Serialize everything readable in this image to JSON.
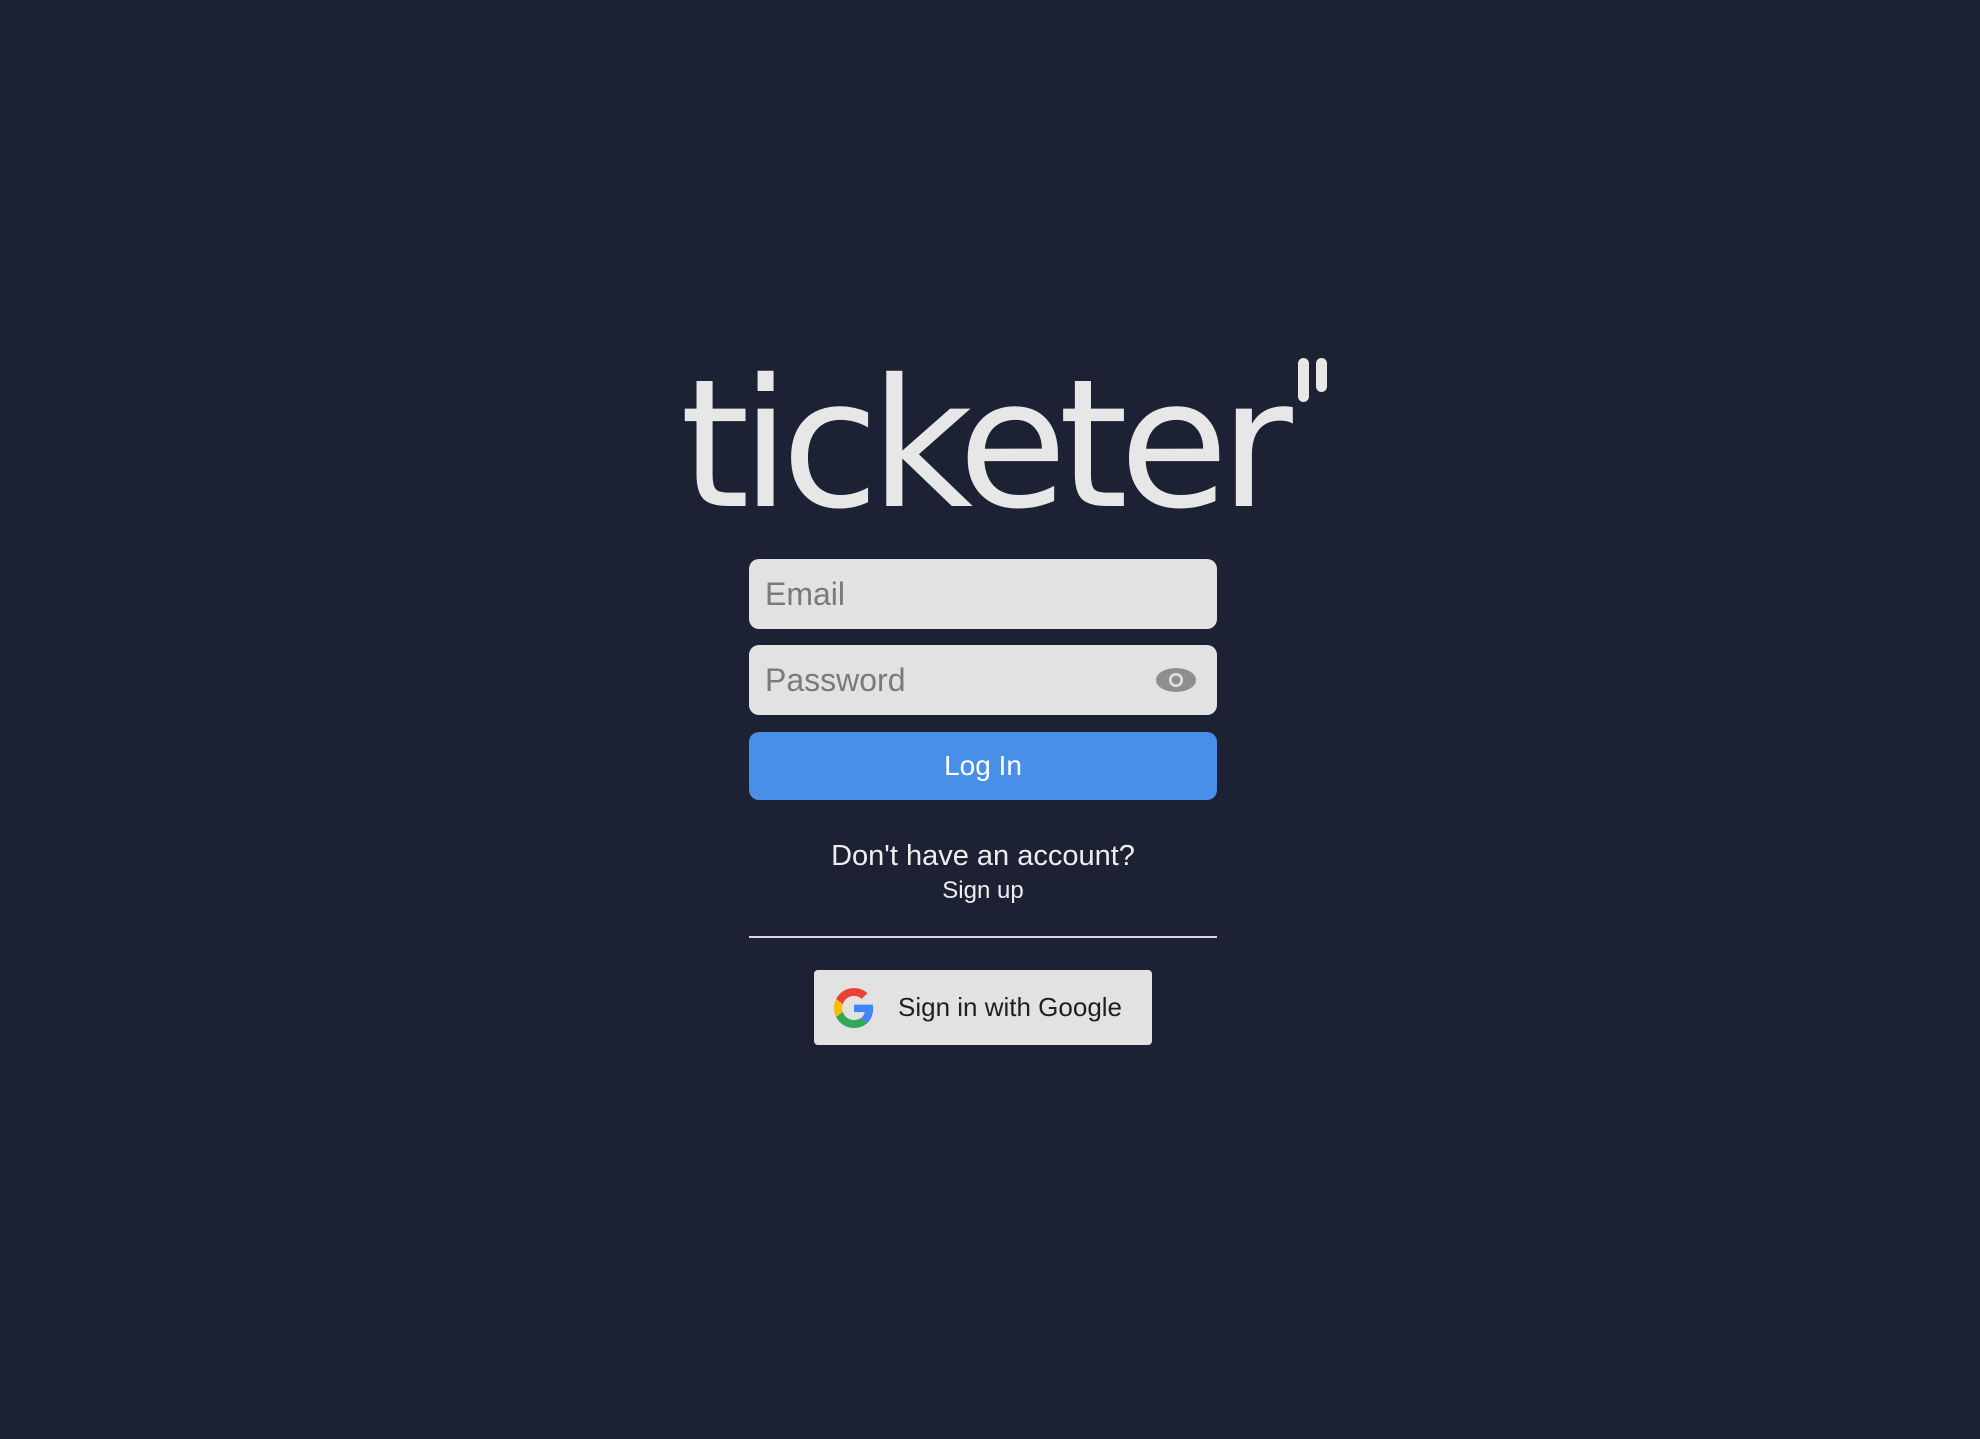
{
  "brand": {
    "logo_text": "ticketer"
  },
  "login_form": {
    "email_placeholder": "Email",
    "password_placeholder": "Password",
    "password_toggle_icon": "eye-icon",
    "login_button_label": "Log In"
  },
  "signup_prompt": {
    "question": "Don't have an account?",
    "link_label": "Sign up"
  },
  "google_sign_in": {
    "label": "Sign in with Google",
    "icon": "google-icon"
  },
  "colors": {
    "background": "#1c2133",
    "accent": "#4a8fe7",
    "field_background": "#e2e2e2",
    "logo": "#e7e7e7"
  }
}
